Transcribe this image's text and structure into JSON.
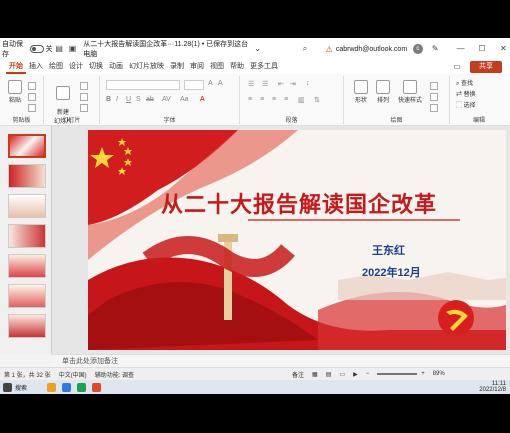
{
  "titlebar": {
    "autosave_label": "自动保存",
    "autosave_state": "关",
    "doc_title": "从二十大报告解读国企改革···11.28(1) • 已保存到这台电脑",
    "account_email": "cabrwdh@outlook.com",
    "avatar_letter": "c"
  },
  "menubar": {
    "tabs": [
      "开始",
      "插入",
      "绘图",
      "设计",
      "切换",
      "动画",
      "幻灯片放映",
      "录制",
      "审阅",
      "视图",
      "帮助",
      "更多工具"
    ],
    "share_label": "共享"
  },
  "ribbon": {
    "paste_label": "粘贴",
    "new_slide_label": "新建\n幻灯片",
    "shapes_label": "形状",
    "arrange_label": "排列",
    "quick_styles_label": "快速样式",
    "find_label": "查找",
    "replace_label": "替换",
    "select_label": "选择",
    "groups": {
      "clipboard": "剪贴板",
      "slides": "幻灯片",
      "font": "字体",
      "paragraph": "段落",
      "drawing": "绘图",
      "editing": "编辑"
    }
  },
  "slide": {
    "title": "从二十大报告解读国企改革",
    "author": "王东红",
    "date": "2022年12月"
  },
  "notes_placeholder": "单击此处添加备注",
  "status": {
    "slide_count": "第 1 张，共 32 张",
    "language": "中文(中国)",
    "accessibility": "辅助功能: 调查",
    "notes_btn": "备注",
    "zoom": "89%"
  },
  "taskbar": {
    "search_label": "搜索",
    "time": "11:11",
    "date": "2022/12/8"
  },
  "colors": {
    "accent": "#c43e1c",
    "title_red": "#c41a1a",
    "navy": "#1d3d8f"
  }
}
